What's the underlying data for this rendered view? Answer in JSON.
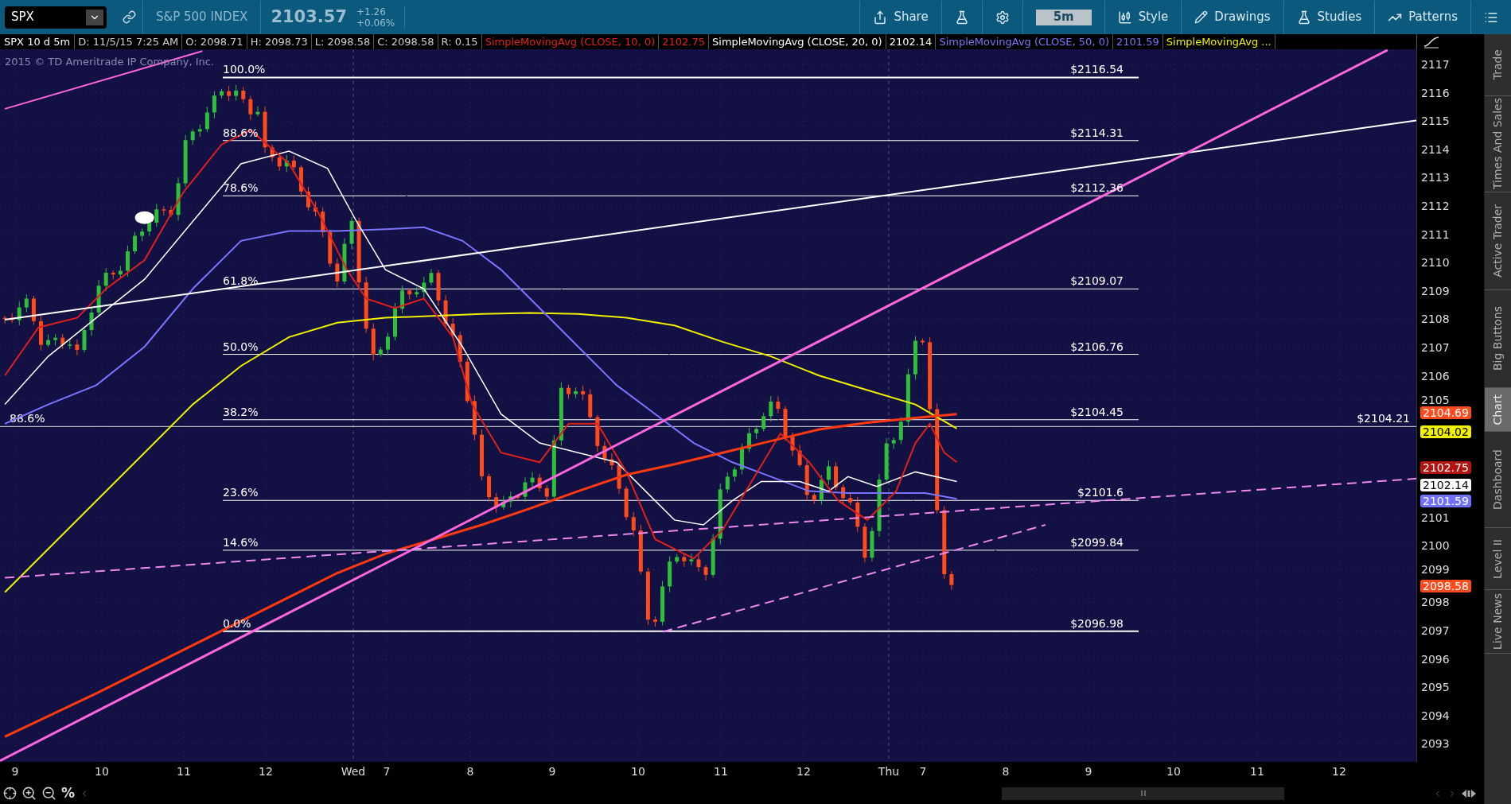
{
  "toolbar": {
    "symbol": "SPX",
    "description": "S&P 500 INDEX",
    "last": "2103.57",
    "change": "+1.26",
    "change_pct": "+0.06%",
    "share": "Share",
    "aggregation": "5m",
    "style": "Style",
    "drawings": "Drawings",
    "studies": "Studies",
    "patterns": "Patterns"
  },
  "info_bar": {
    "title": "SPX 10 d 5m",
    "fields": [
      "D: 11/5/15 7:25 AM",
      "O: 2098.71",
      "H: 2098.73",
      "L: 2098.58",
      "C: 2098.58",
      "R: 0.15"
    ]
  },
  "studies": [
    {
      "name": "SimpleMovingAvg (CLOSE, 10, 0)",
      "value": "2102.75",
      "color": "#e0201a"
    },
    {
      "name": "SimpleMovingAvg (CLOSE, 20, 0)",
      "value": "2102.14",
      "color": "#ffffff"
    },
    {
      "name": "SimpleMovingAvg (CLOSE, 50, 0)",
      "value": "2101.59",
      "color": "#7b74ff"
    },
    {
      "name": "SimpleMovingAvg ...",
      "color": "#f0f000",
      "axis_value": "2104.02"
    }
  ],
  "chart": {
    "copyright": "2015 © TD Ameritrade IP Company, Inc.",
    "fib_levels": [
      {
        "percent": "100.0%",
        "price": "$2116.54"
      },
      {
        "percent": "88.6%",
        "price": "$2114.31"
      },
      {
        "percent": "78.6%",
        "price": "$2112.36"
      },
      {
        "percent": "61.8%",
        "price": "$2109.07"
      },
      {
        "percent": "50.0%",
        "price": "$2106.76"
      },
      {
        "percent": "38.2%",
        "price": "$2104.45"
      },
      {
        "percent": "23.6%",
        "price": "$2101.6"
      },
      {
        "percent": "14.6%",
        "price": "$2099.84"
      },
      {
        "percent": "0.0%",
        "price": "$2096.98"
      }
    ],
    "hline": {
      "left_label": "88.6%",
      "right_label": "$2104.21"
    },
    "price_ticks": [
      "2117",
      "2116",
      "2115",
      "2114",
      "2113",
      "2112",
      "2111",
      "2110",
      "2109",
      "2108",
      "2107",
      "2106",
      "2105",
      "2101",
      "2100",
      "2099",
      "2098",
      "2097",
      "2096",
      "2095",
      "2094",
      "2093"
    ],
    "price_badges": [
      {
        "value": "2104.69",
        "color": "#ff4a1c"
      },
      {
        "value": "2102.75",
        "color": "#b3140f"
      },
      {
        "value": "2102.14",
        "color": "#ffffff"
      },
      {
        "value": "2101.59",
        "color": "#7070ff"
      },
      {
        "value": "2098.58",
        "color": "#ff4a1c"
      }
    ],
    "time_labels": [
      "9",
      "10",
      "11",
      "12",
      "Wed",
      "7",
      "8",
      "9",
      "10",
      "11",
      "12",
      "Thu",
      "7",
      "8",
      "9",
      "10",
      "11",
      "12"
    ]
  },
  "bottom": {
    "percent_button": "%"
  },
  "side_tabs": [
    {
      "label": "Trade",
      "selected": false
    },
    {
      "label": "Times And Sales",
      "selected": false
    },
    {
      "label": "Active Trader",
      "selected": false
    },
    {
      "label": "Big Buttons",
      "selected": false
    },
    {
      "label": "Chart",
      "selected": true
    },
    {
      "label": "Dashboard",
      "selected": false
    },
    {
      "label": "Level II",
      "selected": false
    },
    {
      "label": "Live News",
      "selected": false
    }
  ]
}
